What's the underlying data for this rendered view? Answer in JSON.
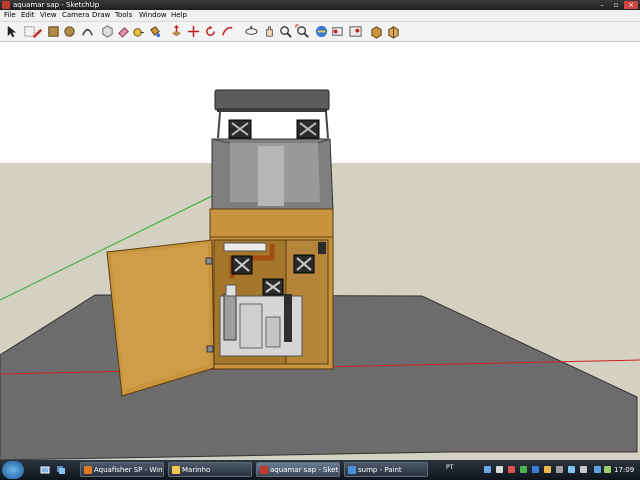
{
  "window": {
    "title": "aquamar sap - SketchUp"
  },
  "menu": {
    "items": [
      "File",
      "Edit",
      "View",
      "Camera",
      "Draw",
      "Tools",
      "Window",
      "Help"
    ]
  },
  "toolbar": {
    "tools": [
      "select-icon",
      "make-component-icon",
      "eraser-icon",
      "pencil-icon",
      "rectangle-icon",
      "circle-icon",
      "arc-icon",
      "offset-icon",
      "push-pull-icon",
      "follow-me-icon",
      "paint-bucket-icon",
      "move-icon",
      "rotate-icon",
      "scale-icon",
      "tape-measure-icon",
      "orbit-icon",
      "pan-icon",
      "zoom-icon",
      "zoom-extents-icon",
      "get-models-icon",
      "share-model-icon",
      "photo-texture-icon",
      "components-icon",
      "share-component-icon"
    ]
  },
  "taskbar": {
    "start_label": "",
    "buttons": [
      {
        "label": "Aquafisher SP - Win...",
        "icon_color": "#e07b1f"
      },
      {
        "label": "Marinho",
        "icon_color": "#f2c94c"
      },
      {
        "label": "aquamar sap - Sket...",
        "icon_color": "#c0392b"
      },
      {
        "label": "sump - Paint",
        "icon_color": "#4a90d9"
      }
    ],
    "language": "PT",
    "clock": "17:09"
  },
  "colors": {
    "titlebar": "#1e1e1e",
    "sky": "#ffffff",
    "ground": "#d4d0c2",
    "floor_plane": "#6c6c6c",
    "cabinet_wood": "#c8943e",
    "cabinet_interior": "#a5772c",
    "glass": "#7f7f7f",
    "axis_red": "#cc2222",
    "axis_green": "#33aa33"
  }
}
